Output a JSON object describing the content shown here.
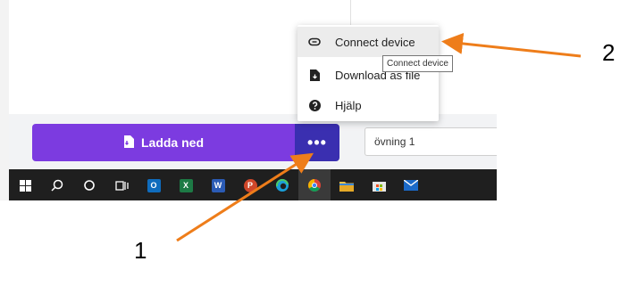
{
  "app": {
    "download_label": "Ladda ned",
    "more_label": "•••",
    "project_name_value": "övning 1"
  },
  "menu": {
    "items": [
      {
        "label": "Connect device",
        "icon": "link-icon"
      },
      {
        "label": "Download as file",
        "icon": "file-download-icon"
      },
      {
        "label": "Hjälp",
        "icon": "help-icon"
      }
    ],
    "tooltip": "Connect device"
  },
  "taskbar": {
    "icons": [
      "windows-start-icon",
      "search-icon",
      "cortana-icon",
      "task-view-icon",
      "outlook-icon",
      "excel-icon",
      "word-icon",
      "powerpoint-icon",
      "edge-icon",
      "chrome-icon",
      "file-explorer-icon",
      "store-icon",
      "mail-icon"
    ]
  },
  "annotations": {
    "label_1": "1",
    "label_2": "2",
    "arrow_color": "#ee7d1a"
  },
  "colors": {
    "accent": "#7c3be0",
    "accent_dark": "#3a2fb0"
  }
}
